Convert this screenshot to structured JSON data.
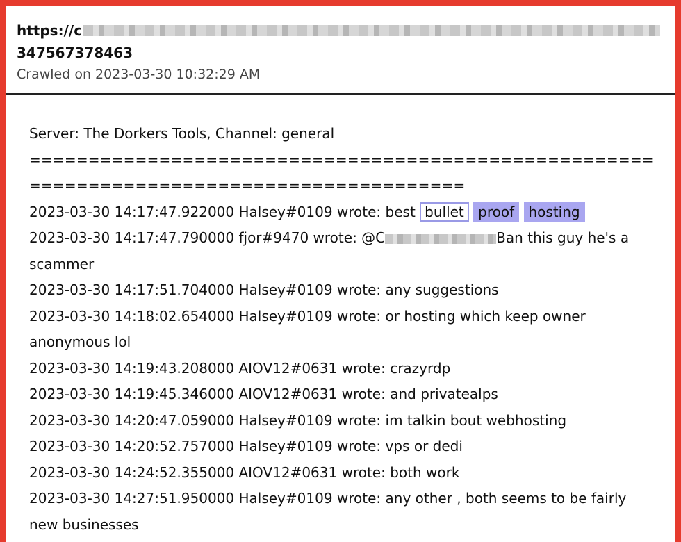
{
  "header": {
    "url_prefix": "https://c",
    "id": "347567378463",
    "crawled": "Crawled on 2023-03-30 10:32:29 AM"
  },
  "content": {
    "server_line": "Server: The Dorkers Tools, Channel: general",
    "separator": "==========================================================================================",
    "messages": [
      {
        "pre": "2023-03-30 14:17:47.922000 Halsey#0109 wrote: best ",
        "h1": "bullet",
        "h2": "proof",
        "h3": "hosting"
      },
      {
        "pre": "2023-03-30 14:17:47.790000 fjor#9470 wrote: @C",
        "post": "Ban this guy he's a scammer"
      },
      {
        "text": "2023-03-30 14:17:51.704000 Halsey#0109 wrote: any suggestions"
      },
      {
        "text": "2023-03-30 14:18:02.654000 Halsey#0109 wrote: or hosting which keep owner anonymous lol"
      },
      {
        "text": "2023-03-30 14:19:43.208000 AIOV12#0631 wrote: crazyrdp"
      },
      {
        "text": "2023-03-30 14:19:45.346000 AIOV12#0631 wrote: and privatealps"
      },
      {
        "text": "2023-03-30 14:20:47.059000 Halsey#0109 wrote: im talkin bout webhosting"
      },
      {
        "text": "2023-03-30 14:20:52.757000 Halsey#0109 wrote: vps or dedi"
      },
      {
        "text": "2023-03-30 14:24:52.355000 AIOV12#0631 wrote: both work"
      },
      {
        "text": "2023-03-30 14:27:51.950000 Halsey#0109 wrote: any other , both seems to be fairly new businesses"
      }
    ]
  }
}
